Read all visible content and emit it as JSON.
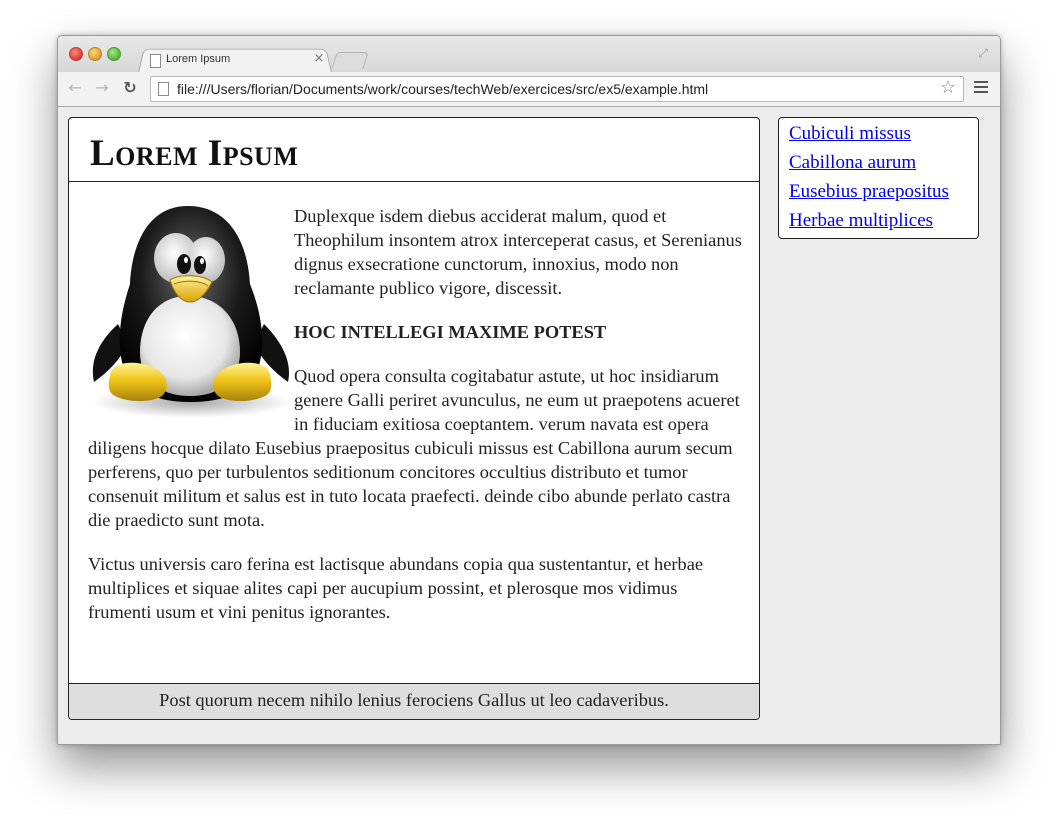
{
  "browser": {
    "tab_title": "Lorem Ipsum",
    "tab_close": "×",
    "url": "file:///Users/florian/Documents/work/courses/techWeb/exercices/src/ex5/example.html"
  },
  "page": {
    "title": "Lorem Ipsum",
    "paragraph_1": "Duplexque isdem diebus acciderat malum, quod et Theophilum insontem atrox interceperat casus, et Serenianus dignus exsecratione cunctorum, innoxius, modo non reclamante publico vigore, discessit.",
    "heading": "Hoc intellegi maxime potest",
    "paragraph_2": "Quod opera consulta cogitabatur astute, ut hoc insidiarum genere Galli periret avunculus, ne eum ut praepotens acueret in fiduciam exitiosa coeptantem. verum navata est opera diligens hocque dilato Eusebius praepositus cubiculi missus est Cabillona aurum secum perferens, quo per turbulentos seditionum concitores occultius distributo et tumor consenuit militum et salus est in tuto locata praefecti. deinde cibo abunde perlato castra die praedicto sunt mota.",
    "paragraph_3": "Victus universis caro ferina est lactisque abundans copia qua sustentantur, et herbae multiplices et siquae alites capi per aucupium possint, et plerosque mos vidimus frumenti usum et vini penitus ignorantes.",
    "footer": "Post quorum necem nihilo lenius ferociens Gallus ut leo cadaveribus."
  },
  "sidebar": {
    "links": [
      {
        "label": "Cubiculi missus"
      },
      {
        "label": "Cabillona aurum"
      },
      {
        "label": "Eusebius praepositus"
      },
      {
        "label": "Herbae multiplices"
      }
    ]
  },
  "colors": {
    "link": "#0000ee",
    "footer_bg": "#dedede",
    "page_bg": "#ececec"
  },
  "icons": [
    "window-close-icon",
    "window-minimize-icon",
    "window-zoom-icon",
    "page-icon",
    "tab-close-icon",
    "back-arrow-icon",
    "forward-arrow-icon",
    "reload-icon",
    "bookmark-star-icon",
    "menu-icon",
    "fullscreen-icon",
    "tux-penguin-image"
  ]
}
